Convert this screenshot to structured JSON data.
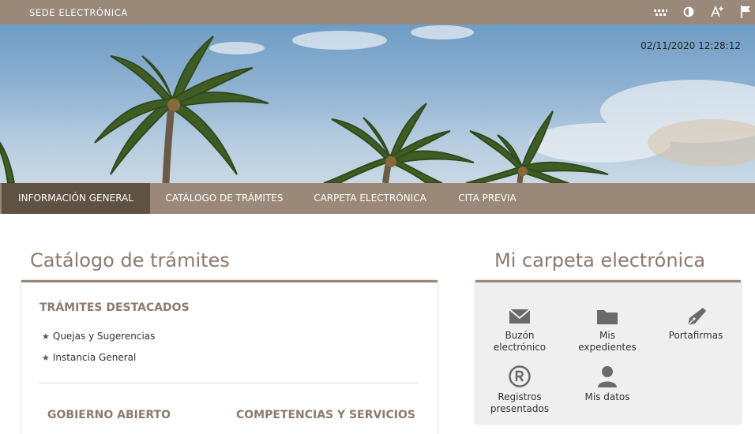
{
  "header": {
    "site_title": "SEDE ELECTRÓNICA",
    "icons": [
      "apps-icon",
      "contrast-icon",
      "font-size-icon",
      "flag-icon"
    ]
  },
  "hero": {
    "datetime": "02/11/2020 12:28:12"
  },
  "nav": {
    "items": [
      {
        "label": "INFORMACIÓN GENERAL",
        "active": true
      },
      {
        "label": "CATÁLOGO DE TRÁMITES",
        "active": false
      },
      {
        "label": "CARPETA ELECTRÓNICA",
        "active": false
      },
      {
        "label": "CITA PREVIA",
        "active": false
      }
    ]
  },
  "catalog": {
    "title": "Catálogo de trámites",
    "featured_heading": "TRÁMITES DESTACADOS",
    "featured_items": [
      "Quejas y Sugerencias",
      "Instancia General"
    ],
    "sections": [
      "GOBIERNO ABIERTO",
      "COMPETENCIAS Y SERVICIOS"
    ]
  },
  "folder": {
    "title": "Mi carpeta electrónica",
    "tiles": [
      {
        "line1": "Buzón",
        "line2": "electrónico",
        "icon": "envelope-icon"
      },
      {
        "line1": "Mis",
        "line2": "expedientes",
        "icon": "folder-icon"
      },
      {
        "line1": "Portafirmas",
        "line2": "",
        "icon": "pen-nib-icon"
      },
      {
        "line1": "Registros",
        "line2": "presentados",
        "icon": "registered-icon"
      },
      {
        "line1": "Mis datos",
        "line2": "",
        "icon": "user-icon"
      }
    ]
  },
  "colors": {
    "brand": "#9a8878",
    "brand_dark": "#5f5143",
    "heading": "#8b7b6b"
  }
}
